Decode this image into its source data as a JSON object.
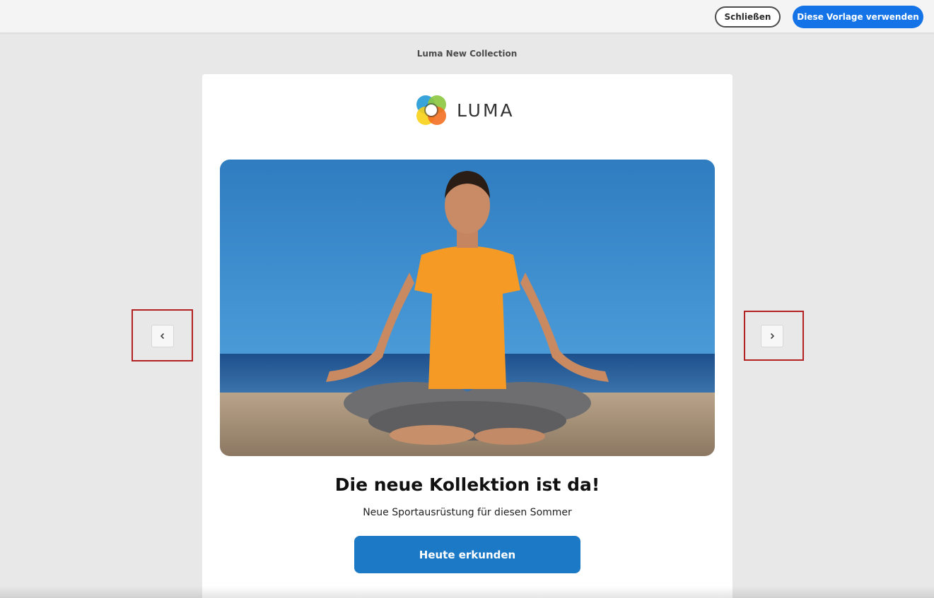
{
  "header": {
    "close_label": "Schließen",
    "use_template_label": "Diese Vorlage verwenden"
  },
  "preview": {
    "title": "Luma New Collection"
  },
  "email": {
    "logo_text": "LUMA",
    "headline": "Die neue Kollektion ist da!",
    "subline": "Neue Sportausrüstung für diesen Sommer",
    "cta_label": "Heute erkunden",
    "hero_image": "woman-meditating-on-beach"
  },
  "navigation": {
    "prev_icon": "chevron-left-icon",
    "next_icon": "chevron-right-icon"
  },
  "colors": {
    "primary_blue": "#1473e6",
    "cta_blue": "#1c79c6",
    "highlight_red": "#b22222",
    "background": "#e8e8e8"
  }
}
